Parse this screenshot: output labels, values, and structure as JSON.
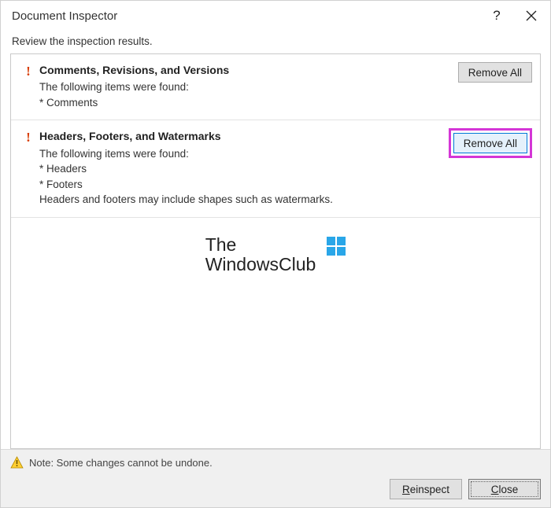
{
  "window": {
    "title": "Document Inspector"
  },
  "instruction": "Review the inspection results.",
  "results": [
    {
      "title": "Comments, Revisions, and Versions",
      "found_intro": "The following items were found:",
      "bullet1": "* Comments",
      "bullet2": "",
      "note": "",
      "action": "Remove All"
    },
    {
      "title": "Headers, Footers, and Watermarks",
      "found_intro": "The following items were found:",
      "bullet1": "* Headers",
      "bullet2": "* Footers",
      "note": "Headers and footers may include shapes such as watermarks.",
      "action": "Remove All"
    }
  ],
  "watermark": {
    "line1": "The",
    "line2": "WindowsClub"
  },
  "footer": {
    "note": "Note: Some changes cannot be undone.",
    "reinspect_pre": "R",
    "reinspect_post": "einspect",
    "close_pre": "C",
    "close_post": "lose"
  }
}
